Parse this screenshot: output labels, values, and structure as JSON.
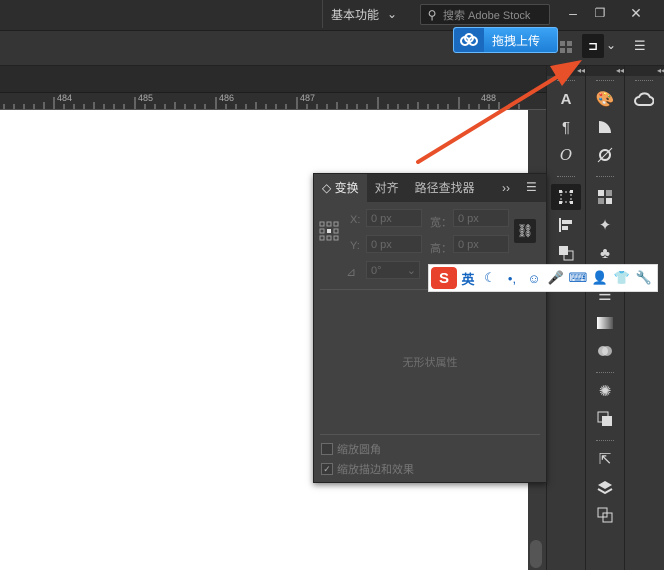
{
  "topbar": {
    "workspace_label": "基本功能",
    "workspace_caret": "⌄",
    "search_placeholder": "搜索 Adobe Stock"
  },
  "upload": {
    "label": "拖拽上传"
  },
  "ruler": {
    "ticks": [
      "484",
      "485",
      "486",
      "487",
      "488"
    ]
  },
  "panel": {
    "tabs": [
      "变换",
      "对齐",
      "路径查找器"
    ],
    "fields": {
      "x_label": "X:",
      "x_value": "0 px",
      "w_label": "宽：",
      "w_value": "0 px",
      "y_label": "Y:",
      "y_value": "0 px",
      "h_label": "高：",
      "h_value": "0 px",
      "angle_value": "0°"
    },
    "no_shape_text": "无形状属性",
    "checkbox_scale_corners": "缩放圆角",
    "checkbox_scale_stroke": "缩放描边和效果"
  },
  "ime": {
    "logo": "S",
    "mode": "英"
  },
  "colors": {
    "arrow": "#e8502a",
    "upload_blue": "#2b8fe8"
  }
}
